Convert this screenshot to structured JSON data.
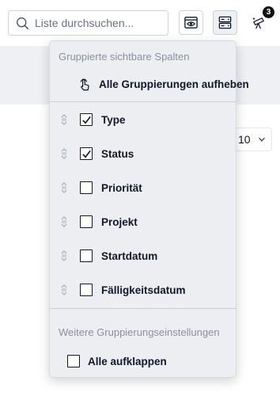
{
  "search": {
    "placeholder": "Liste durchsuchen..."
  },
  "toolbar": {
    "view_icon": "eye-window-icon",
    "group_icon": "server-stack-icon",
    "filter_icon": "telescope-icon",
    "filter_badge": "3"
  },
  "pagination": {
    "page_size": "10"
  },
  "group_menu": {
    "title": "Gruppierte sichtbare Spalten",
    "ungroup_all_label": "Alle Gruppierungen aufheben",
    "columns": [
      {
        "label": "Type",
        "checked": true
      },
      {
        "label": "Status",
        "checked": true
      },
      {
        "label": "Priorität",
        "checked": false
      },
      {
        "label": "Projekt",
        "checked": false
      },
      {
        "label": "Startdatum",
        "checked": false
      },
      {
        "label": "Fälligkeitsdatum",
        "checked": false
      }
    ],
    "more_settings_title": "Weitere Gruppierungseinstellungen",
    "expand_all": {
      "label": "Alle aufklappen",
      "checked": false
    }
  }
}
